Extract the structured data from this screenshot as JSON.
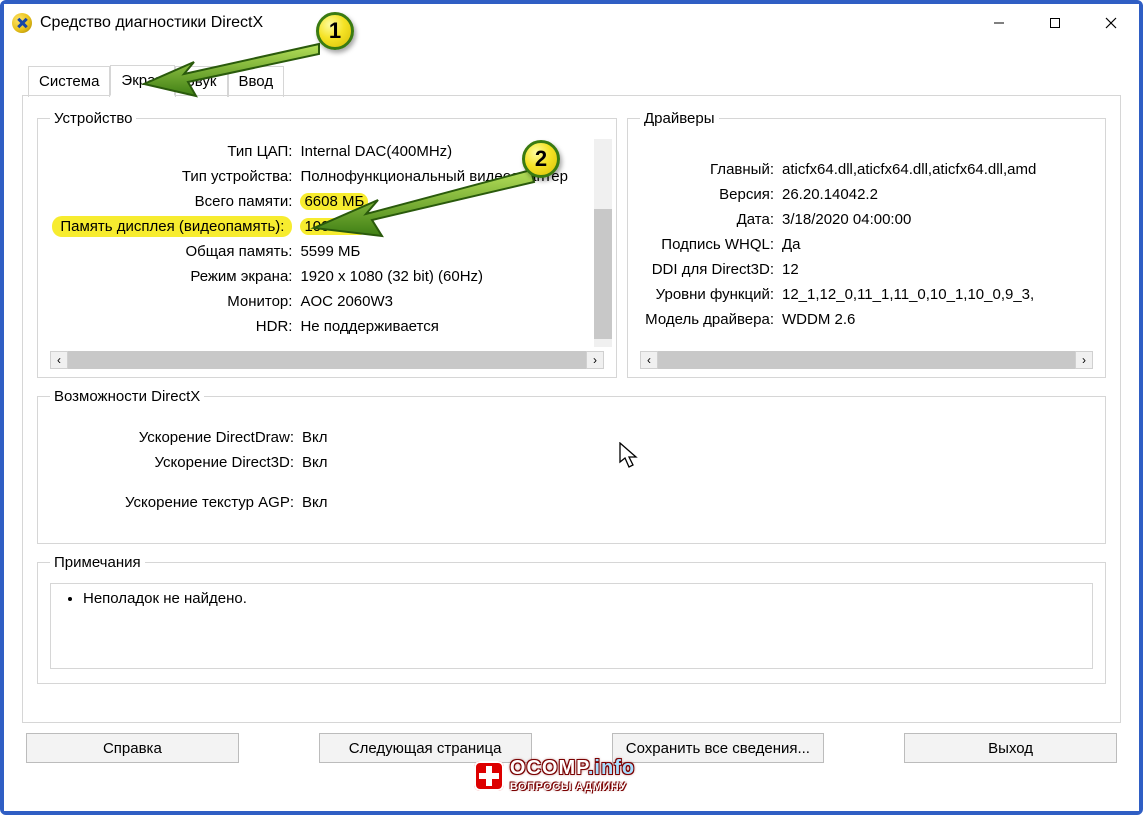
{
  "window": {
    "title": "Средство диагностики DirectX"
  },
  "tabs": [
    "Система",
    "Экран",
    "Звук",
    "Ввод"
  ],
  "active_tab": 1,
  "device": {
    "legend": "Устройство",
    "rows": [
      {
        "label": "Тип ЦАП:",
        "value": "Internal DAC(400MHz)"
      },
      {
        "label": "Тип устройства:",
        "value": "Полнофункциональный видеоадаптер"
      },
      {
        "label": "Всего памяти:",
        "value": "6608 МБ"
      },
      {
        "label": "Память дисплея (видеопамять):",
        "value": "1009 МБ",
        "highlight": true
      },
      {
        "label": "Общая память:",
        "value": "5599 МБ"
      },
      {
        "label": "Режим экрана:",
        "value": "1920 x 1080 (32 bit) (60Hz)"
      },
      {
        "label": "Монитор:",
        "value": "AOC 2060W3"
      },
      {
        "label": "HDR:",
        "value": "Не поддерживается"
      }
    ]
  },
  "drivers": {
    "legend": "Драйверы",
    "rows": [
      {
        "label": "Главный:",
        "value": "aticfx64.dll,aticfx64.dll,aticfx64.dll,amd"
      },
      {
        "label": "Версия:",
        "value": "26.20.14042.2"
      },
      {
        "label": "Дата:",
        "value": "3/18/2020 04:00:00"
      },
      {
        "label": "Подпись WHQL:",
        "value": "Да"
      },
      {
        "label": "DDI для Direct3D:",
        "value": "12"
      },
      {
        "label": "Уровни функций:",
        "value": "12_1,12_0,11_1,11_0,10_1,10_0,9_3,"
      },
      {
        "label": "Модель драйвера:",
        "value": "WDDM 2.6"
      }
    ]
  },
  "capabilities": {
    "legend": "Возможности DirectX",
    "rows": [
      {
        "label": "Ускорение DirectDraw:",
        "value": "Вкл"
      },
      {
        "label": "Ускорение Direct3D:",
        "value": "Вкл"
      },
      {
        "label": "Ускорение текстур AGP:",
        "value": "Вкл"
      }
    ]
  },
  "notes": {
    "legend": "Примечания",
    "item": "Неполадок не найдено."
  },
  "buttons": {
    "help": "Справка",
    "next": "Следующая страница",
    "save": "Сохранить все сведения...",
    "exit": "Выход"
  },
  "callouts": {
    "c1": "1",
    "c2": "2"
  },
  "watermark": {
    "line1a": "OCOMP",
    "line1b": ".info",
    "line2": "ВОПРОСЫ АДМИНУ"
  }
}
